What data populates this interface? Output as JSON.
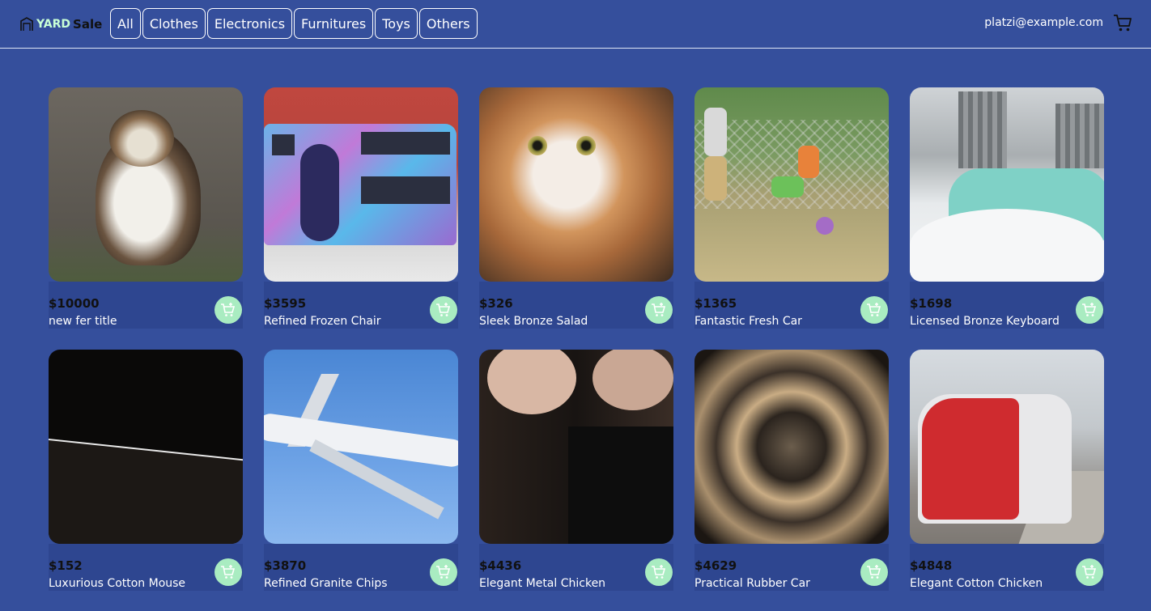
{
  "header": {
    "brand_yard": "YARD",
    "brand_sale": "Sale",
    "tabs": [
      "All",
      "Clothes",
      "Electronics",
      "Furnitures",
      "Toys",
      "Others"
    ],
    "user_email": "platzi@example.com",
    "cart_icon": "cart-icon"
  },
  "products": [
    {
      "price": "$10000",
      "title": "new fer title",
      "image": "long-haired-cat"
    },
    {
      "price": "$3595",
      "title": "Refined Frozen Chair",
      "image": "double-decker-bus"
    },
    {
      "price": "$326",
      "title": "Sleek Bronze Salad",
      "image": "orange-white-cat"
    },
    {
      "price": "$1365",
      "title": "Fantastic Fresh Car",
      "image": "kids-playing-ball"
    },
    {
      "price": "$1698",
      "title": "Licensed Bronze Keyboard",
      "image": "car-in-snow"
    },
    {
      "price": "$152",
      "title": "Luxurious Cotton Mouse",
      "image": "dark-hillside"
    },
    {
      "price": "$3870",
      "title": "Refined Granite Chips",
      "image": "airplane-in-sky"
    },
    {
      "price": "$4436",
      "title": "Elegant Metal Chicken",
      "image": "two-people"
    },
    {
      "price": "$4629",
      "title": "Practical Rubber Car",
      "image": "abstract-swirl"
    },
    {
      "price": "$4848",
      "title": "Elegant Cotton Chicken",
      "image": "red-train"
    }
  ],
  "colors": {
    "background": "#354f9c",
    "add_button": "#a9ecc1",
    "brand_yard": "#c8ffd6"
  }
}
